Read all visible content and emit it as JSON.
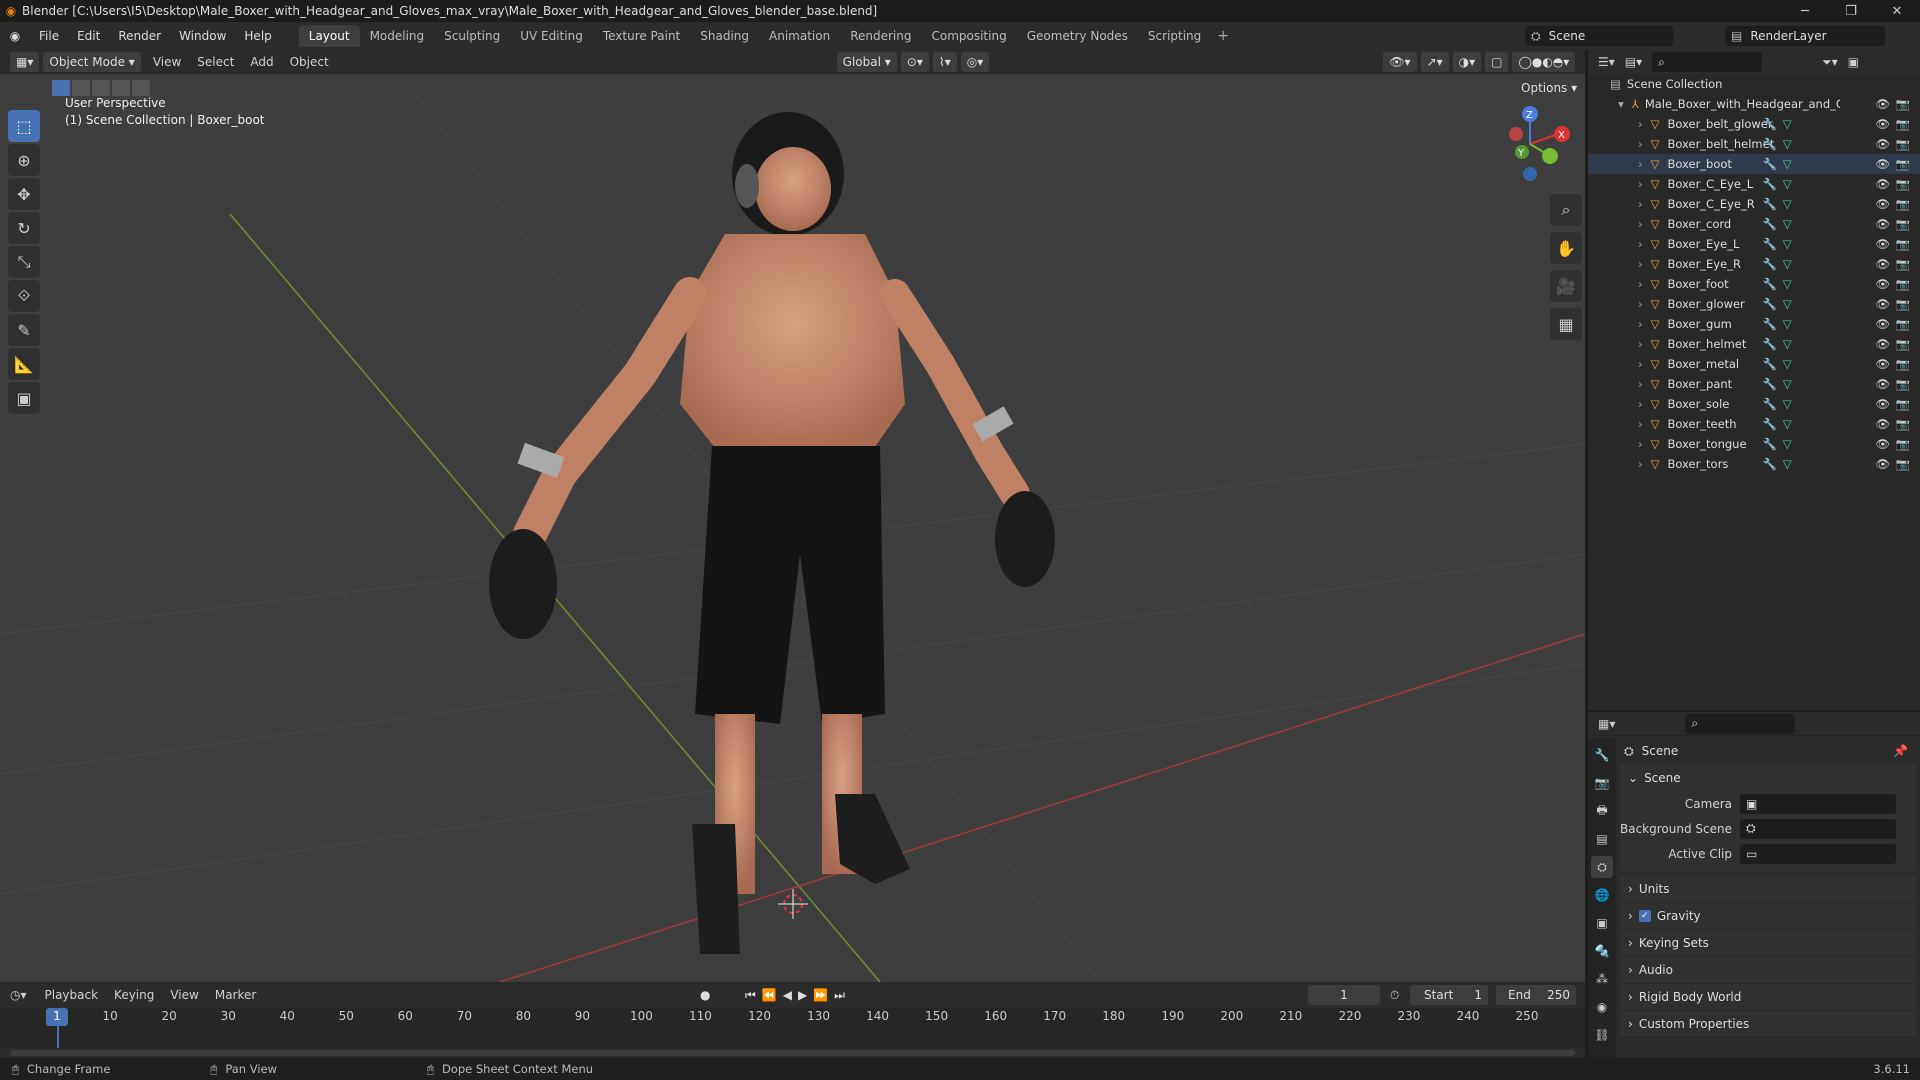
{
  "title": "Blender [C:\\Users\\I5\\Desktop\\Male_Boxer_with_Headgear_and_Gloves_max_vray\\Male_Boxer_with_Headgear_and_Gloves_blender_base.blend]",
  "menu": [
    "File",
    "Edit",
    "Render",
    "Window",
    "Help"
  ],
  "workspaces": [
    "Layout",
    "Modeling",
    "Sculpting",
    "UV Editing",
    "Texture Paint",
    "Shading",
    "Animation",
    "Rendering",
    "Compositing",
    "Geometry Nodes",
    "Scripting"
  ],
  "active_workspace": "Layout",
  "scene_name": "Scene",
  "render_layer": "RenderLayer",
  "viewport": {
    "mode": "Object Mode",
    "menus": [
      "View",
      "Select",
      "Add",
      "Object"
    ],
    "orientation": "Global",
    "options": "Options",
    "overlay_line1": "User Perspective",
    "overlay_line2": "(1) Scene Collection | Boxer_boot",
    "gizmo": {
      "x": "X",
      "y": "Y",
      "z": "Z"
    }
  },
  "outliner": {
    "root": "Scene Collection",
    "collection": "Male_Boxer_with_Headgear_and_Gloves",
    "objects": [
      "Boxer_belt_glower",
      "Boxer_belt_helmet",
      "Boxer_boot",
      "Boxer_C_Eye_L",
      "Boxer_C_Eye_R",
      "Boxer_cord",
      "Boxer_Eye_L",
      "Boxer_Eye_R",
      "Boxer_foot",
      "Boxer_glower",
      "Boxer_gum",
      "Boxer_helmet",
      "Boxer_metal",
      "Boxer_pant",
      "Boxer_sole",
      "Boxer_teeth",
      "Boxer_tongue",
      "Boxer_tors"
    ]
  },
  "properties": {
    "header": "Scene",
    "section": "Scene",
    "camera_label": "Camera",
    "background_scene_label": "Background Scene",
    "active_clip_label": "Active Clip",
    "panels": [
      "Units",
      "Gravity",
      "Keying Sets",
      "Audio",
      "Rigid Body World",
      "Custom Properties"
    ],
    "gravity_checked": true
  },
  "timeline": {
    "menus": [
      "Playback",
      "Keying",
      "View",
      "Marker"
    ],
    "current_frame": "1",
    "start_label": "Start",
    "start": "1",
    "end_label": "End",
    "end": "250",
    "ticks": [
      "1",
      "10",
      "20",
      "30",
      "40",
      "50",
      "60",
      "70",
      "80",
      "90",
      "100",
      "110",
      "120",
      "130",
      "140",
      "150",
      "160",
      "170",
      "180",
      "190",
      "200",
      "210",
      "220",
      "230",
      "240",
      "250"
    ]
  },
  "statusbar": {
    "left": "Change Frame",
    "middle": "Pan View",
    "right": "Dope Sheet Context Menu",
    "version": "3.6.11"
  }
}
